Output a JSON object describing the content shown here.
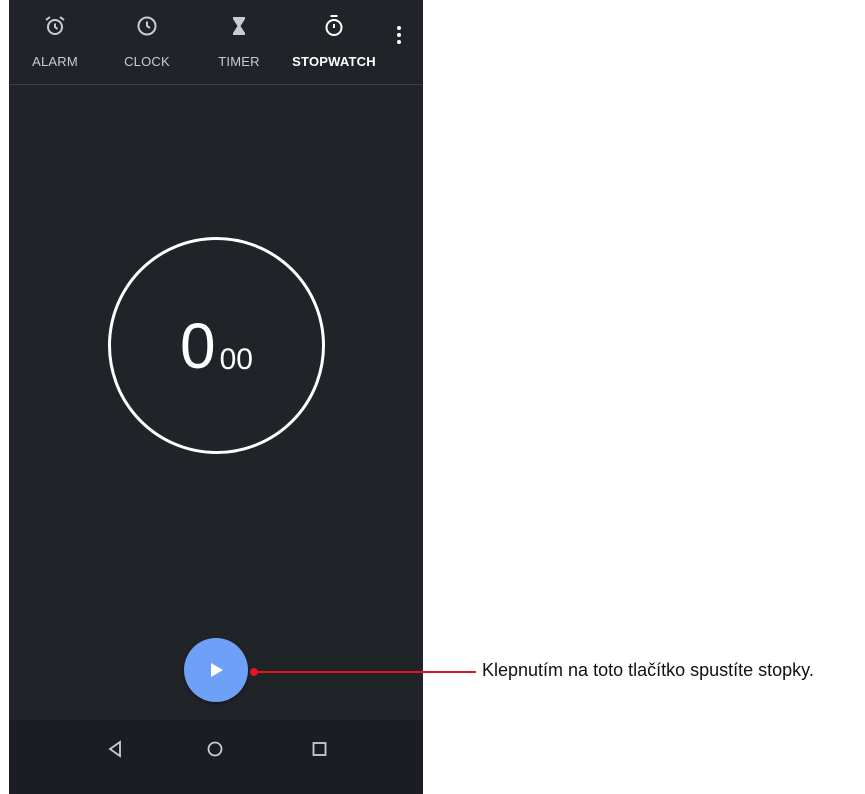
{
  "tabs": [
    {
      "label": "ALARM",
      "icon": "alarm-icon"
    },
    {
      "label": "CLOCK",
      "icon": "clock-icon"
    },
    {
      "label": "TIMER",
      "icon": "hourglass-icon"
    },
    {
      "label": "STOPWATCH",
      "icon": "stopwatch-icon",
      "active": true
    }
  ],
  "stopwatch": {
    "seconds": "0",
    "hundredths": "00"
  },
  "controls": {
    "play_icon": "play-icon"
  },
  "navbar": {
    "icons": [
      "back-icon",
      "home-icon",
      "recents-icon"
    ]
  },
  "callout": {
    "text": "Klepnutím na toto tlačítko spustíte stopky.",
    "color": "#e3141c"
  },
  "colors": {
    "background": "#202428",
    "accent": "#6ea0f7"
  }
}
